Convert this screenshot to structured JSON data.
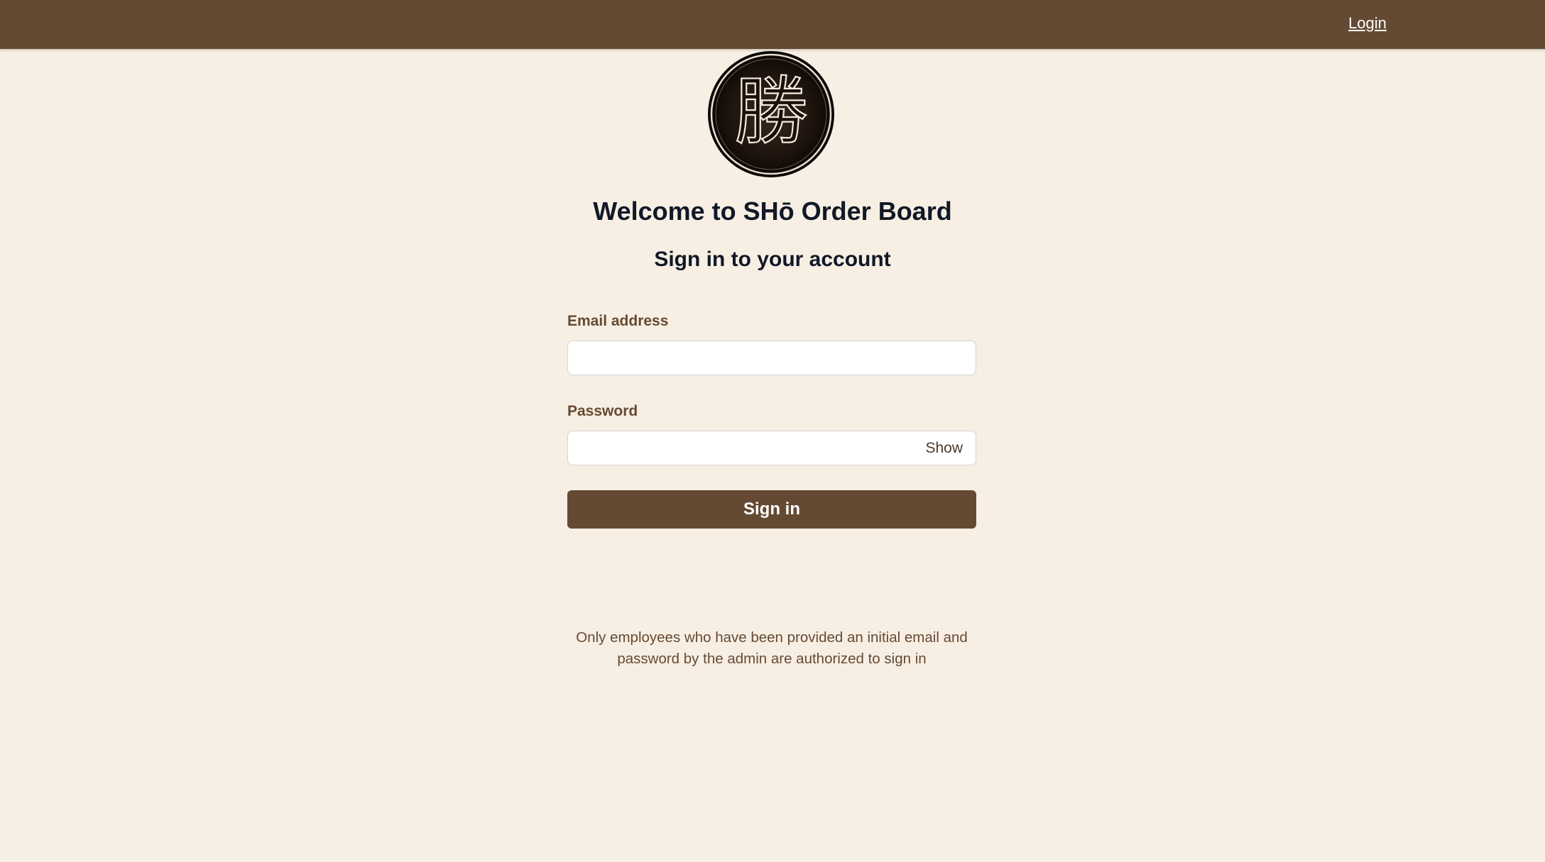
{
  "header": {
    "login_link": "Login",
    "background_color": "#654a33"
  },
  "logo": {
    "icon": "sho-seal-logo-icon",
    "glyph": "勝"
  },
  "welcome": {
    "title": "Welcome to SHō Order Board",
    "subtitle": "Sign in to your account"
  },
  "form": {
    "email": {
      "label": "Email address",
      "value": "",
      "placeholder": ""
    },
    "password": {
      "label": "Password",
      "value": "",
      "placeholder": "",
      "toggle_label": "Show"
    },
    "submit_label": "Sign in"
  },
  "notice": "Only employees who have been provided an initial email and password by the admin are authorized to sign in",
  "colors": {
    "page_background": "#f7efe3",
    "brand": "#654a33",
    "heading_text": "#111827"
  }
}
